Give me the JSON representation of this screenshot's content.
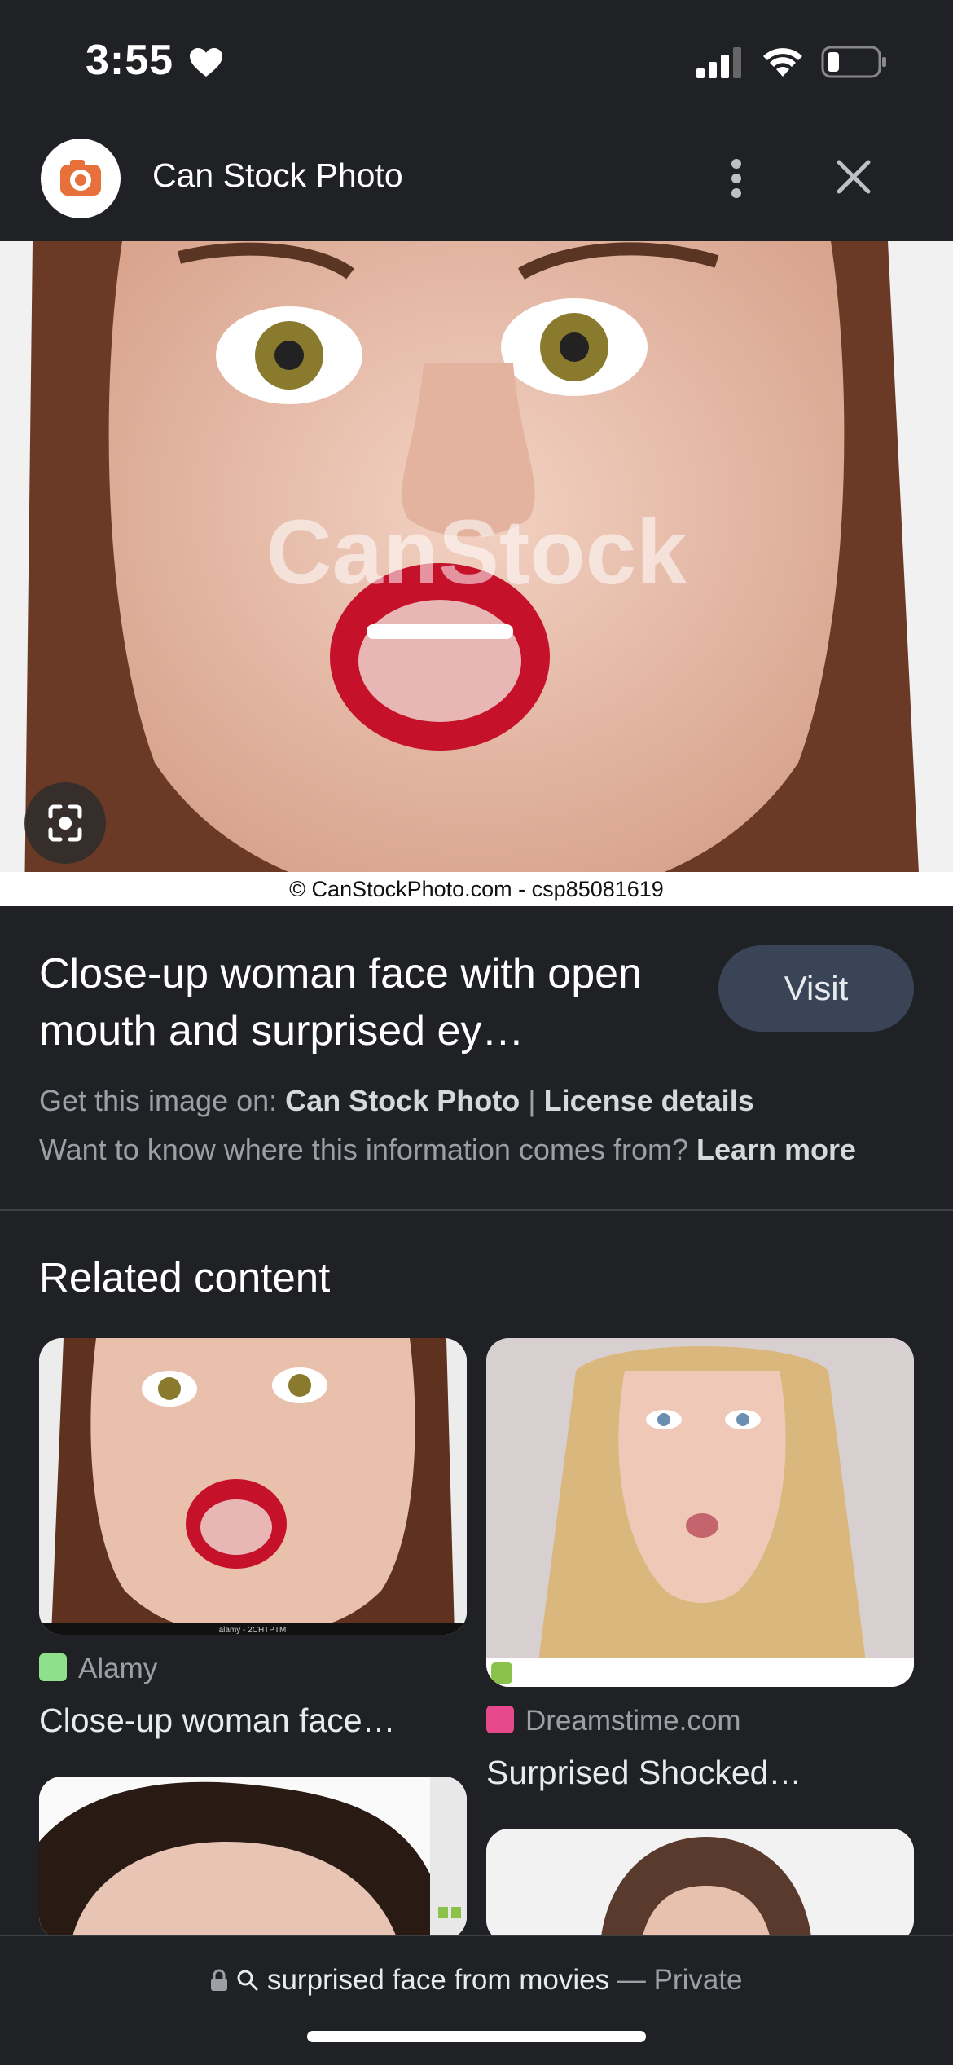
{
  "status_bar": {
    "time": "3:55"
  },
  "header": {
    "site_name": "Can Stock Photo"
  },
  "main_image": {
    "watermark": "CanStock",
    "credit": "© CanStockPhoto.com - csp85081619"
  },
  "result": {
    "title": "Close-up woman face with open mouth and surprised ey…",
    "visit_label": "Visit",
    "source_prefix": "Get this image on:",
    "source_name": "Can Stock Photo",
    "separator": "|",
    "license_label": "License details",
    "info_question": "Want to know where this information comes from?",
    "learn_more": "Learn more"
  },
  "related": {
    "heading": "Related content",
    "cards": [
      {
        "source": "Alamy",
        "title": "Close-up woman face…",
        "badge_color": "#8ee08a",
        "watermark": "alamy - 2CHTPTM"
      },
      {
        "source": "Dreamstime.com",
        "title": "Surprised Shocked…",
        "badge_color": "#e64a8c"
      }
    ]
  },
  "bottom": {
    "query": "surprised face from movies",
    "separator": "—",
    "mode": "Private"
  },
  "colors": {
    "background": "#202124",
    "visit_button": "#394457",
    "logo_orange": "#e8703a"
  }
}
